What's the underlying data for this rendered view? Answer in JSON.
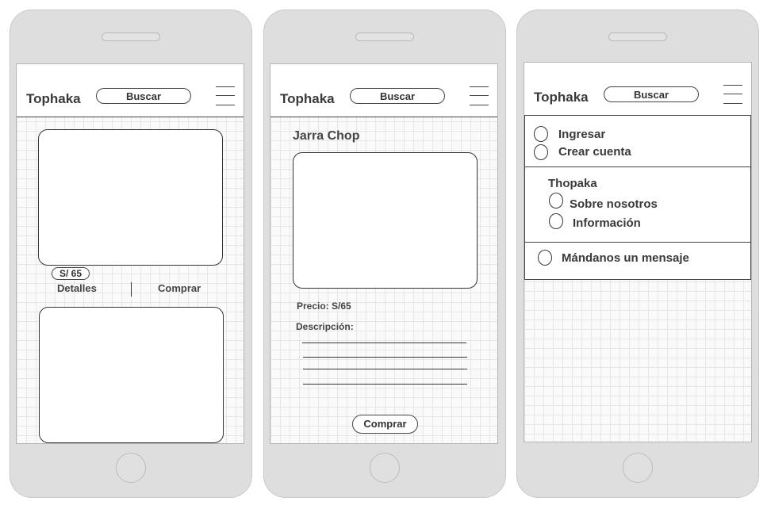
{
  "header": {
    "brand_screen1": "Tophaka",
    "brand_screen2": "Tophaka",
    "brand_screen3": "Tophaka",
    "search_label": "Buscar"
  },
  "catalog": {
    "price": "S/ 65",
    "details_label": "Detalles",
    "buy_label": "Comprar"
  },
  "product": {
    "title": "Jarra Chop",
    "price_label": "Precio: S/65",
    "description_label": "Descripción:",
    "buy_label": "Comprar"
  },
  "menu": {
    "account": [
      "Ingresar",
      "Crear cuenta"
    ],
    "about_title": "Thopaka",
    "about_items": [
      "Sobre nosotros",
      "Información"
    ],
    "contact": "Mándanos un mensaje"
  }
}
